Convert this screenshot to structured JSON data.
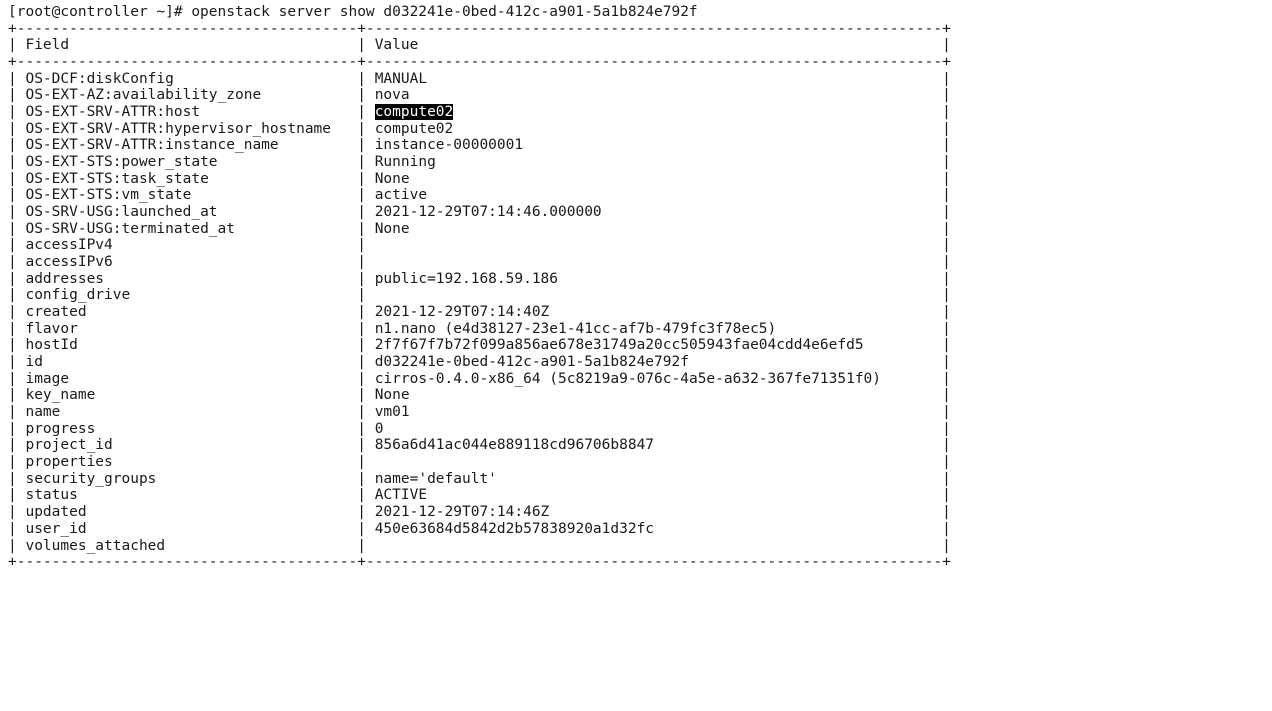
{
  "command": {
    "prompt": "[root@controller ~]# ",
    "cmd": "openstack server show d032241e-0bed-412c-a901-5a1b824e792f"
  },
  "columns": {
    "field_header": "Field",
    "value_header": "Value"
  },
  "highlight_value": "compute02",
  "rows": [
    {
      "field": "OS-DCF:diskConfig",
      "value": "MANUAL",
      "hl": false
    },
    {
      "field": "OS-EXT-AZ:availability_zone",
      "value": "nova",
      "hl": false
    },
    {
      "field": "OS-EXT-SRV-ATTR:host",
      "value": "compute02",
      "hl": true
    },
    {
      "field": "OS-EXT-SRV-ATTR:hypervisor_hostname",
      "value": "compute02",
      "hl": false
    },
    {
      "field": "OS-EXT-SRV-ATTR:instance_name",
      "value": "instance-00000001",
      "hl": false
    },
    {
      "field": "OS-EXT-STS:power_state",
      "value": "Running",
      "hl": false
    },
    {
      "field": "OS-EXT-STS:task_state",
      "value": "None",
      "hl": false
    },
    {
      "field": "OS-EXT-STS:vm_state",
      "value": "active",
      "hl": false
    },
    {
      "field": "OS-SRV-USG:launched_at",
      "value": "2021-12-29T07:14:46.000000",
      "hl": false
    },
    {
      "field": "OS-SRV-USG:terminated_at",
      "value": "None",
      "hl": false
    },
    {
      "field": "accessIPv4",
      "value": "",
      "hl": false
    },
    {
      "field": "accessIPv6",
      "value": "",
      "hl": false
    },
    {
      "field": "addresses",
      "value": "public=192.168.59.186",
      "hl": false
    },
    {
      "field": "config_drive",
      "value": "",
      "hl": false
    },
    {
      "field": "created",
      "value": "2021-12-29T07:14:40Z",
      "hl": false
    },
    {
      "field": "flavor",
      "value": "n1.nano (e4d38127-23e1-41cc-af7b-479fc3f78ec5)",
      "hl": false
    },
    {
      "field": "hostId",
      "value": "2f7f67f7b72f099a856ae678e31749a20cc505943fae04cdd4e6efd5",
      "hl": false
    },
    {
      "field": "id",
      "value": "d032241e-0bed-412c-a901-5a1b824e792f",
      "hl": false
    },
    {
      "field": "image",
      "value": "cirros-0.4.0-x86_64 (5c8219a9-076c-4a5e-a632-367fe71351f0)",
      "hl": false
    },
    {
      "field": "key_name",
      "value": "None",
      "hl": false
    },
    {
      "field": "name",
      "value": "vm01",
      "hl": false
    },
    {
      "field": "progress",
      "value": "0",
      "hl": false
    },
    {
      "field": "project_id",
      "value": "856a6d41ac044e889118cd96706b8847",
      "hl": false
    },
    {
      "field": "properties",
      "value": "",
      "hl": false
    },
    {
      "field": "security_groups",
      "value": "name='default'",
      "hl": false
    },
    {
      "field": "status",
      "value": "ACTIVE",
      "hl": false
    },
    {
      "field": "updated",
      "value": "2021-12-29T07:14:46Z",
      "hl": false
    },
    {
      "field": "user_id",
      "value": "450e63684d5842d2b57838920a1d32fc",
      "hl": false
    },
    {
      "field": "volumes_attached",
      "value": "",
      "hl": false
    }
  ]
}
